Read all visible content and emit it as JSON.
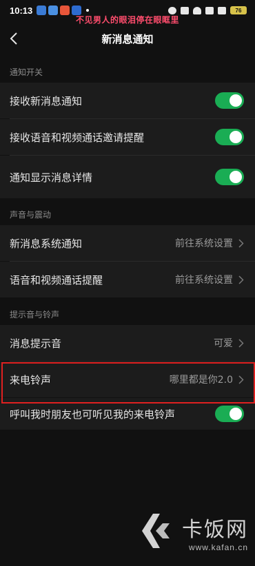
{
  "status_bar": {
    "time": "10:13",
    "battery": "76"
  },
  "overlay_caption": "不见男人的眼泪停在眼眶里",
  "header": {
    "title": "新消息通知"
  },
  "sections": {
    "notify_switch": {
      "title": "通知开关",
      "items": [
        {
          "label": "接收新消息通知",
          "toggle": true
        },
        {
          "label": "接收语音和视频通话邀请提醒",
          "toggle": true
        },
        {
          "label": "通知显示消息详情",
          "toggle": true
        }
      ]
    },
    "sound_vibration": {
      "title": "声音与震动",
      "items": [
        {
          "label": "新消息系统通知",
          "value": "前往系统设置"
        },
        {
          "label": "语音和视频通话提醒",
          "value": "前往系统设置"
        }
      ]
    },
    "tones": {
      "title": "提示音与铃声",
      "items": [
        {
          "label": "消息提示音",
          "value": "可爱"
        },
        {
          "label": "来电铃声",
          "value": "哪里都是你2.0"
        },
        {
          "label": "呼叫我时朋友也可听见我的来电铃声",
          "toggle": true
        }
      ]
    }
  },
  "watermark": {
    "brand": "卡饭网",
    "url": "www.kafan.cn"
  },
  "colors": {
    "toggle_on": "#1aad54",
    "highlight": "#e02020",
    "background": "#111111",
    "row_background": "#1c1c1c"
  }
}
